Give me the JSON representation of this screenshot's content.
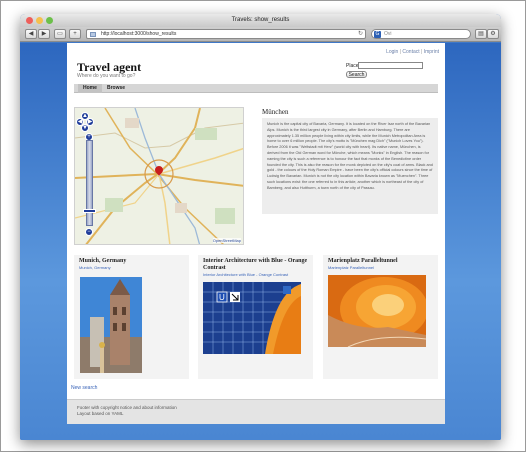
{
  "browser": {
    "title": "Travels: show_results",
    "url": "http://localhost:3000/show_results",
    "search_placeholder": "Ovi",
    "search_engine_letter": "G"
  },
  "header": {
    "top_links": [
      "Login",
      "Contact",
      "Imprint"
    ],
    "brand": "Travel agent",
    "tagline": "Where do you want to go?",
    "place_label": "Place",
    "place_value": "",
    "search_button": "Search"
  },
  "nav": {
    "items": [
      "Home",
      "Browse"
    ]
  },
  "map": {
    "attribution": "OpenStreetMap"
  },
  "city": {
    "title": "München",
    "description": "Munich is the capital city of Bavaria, Germany. It is located on the River Isar north of the Bavarian Alps. Munich is the third largest city in Germany, after Berlin and Hamburg. There are approximately 1.35 million people living within city limits, while the Munich Metropolitan Area is home to over 6 million people. The city's motto is \"München mag Dich\" (\"Munich Loves You\"). Before 2006 it was \"Weltstadt mit Herz\" (world city with heart). Its native name, München, is derived from the Old German word for Mönche, which means \"Monks\" in English. The reason for naming the city is such a reference is to honour the fact that monks of the Benedictine order founded the city. This is also the reason for the monk depicted on the city's coat of arms. Black and gold - the colours of the Holy Roman Empire - have been the city's official colours since the time of Ludwig the Bavarian. Munich is not the city location within Bavaria known as \"Muenchen\". Three such locations exist: the one referred to in this article, another which is northeast of the city of Bamberg, and also Hutthurm, a town north of the city of Passau."
  },
  "cards": [
    {
      "title": "Munich, Germany",
      "link": "Munich, Germany"
    },
    {
      "title": "Interior Architecture with Blue - Orange Contrast",
      "link": "Interior Architecture with Blue - Orange Contrast"
    },
    {
      "title": "Marienplatz Paralleltunnel",
      "link": "Marienplatz Paralleltunnel"
    }
  ],
  "new_search": "New search",
  "footer": {
    "line1": "Footer with copyright notice and about information",
    "line2": "Layout based on YAML"
  },
  "colors": {
    "desktop_blue": "#3f78c8",
    "link": "#3a64b8",
    "map_pin": "#c81e1e"
  }
}
